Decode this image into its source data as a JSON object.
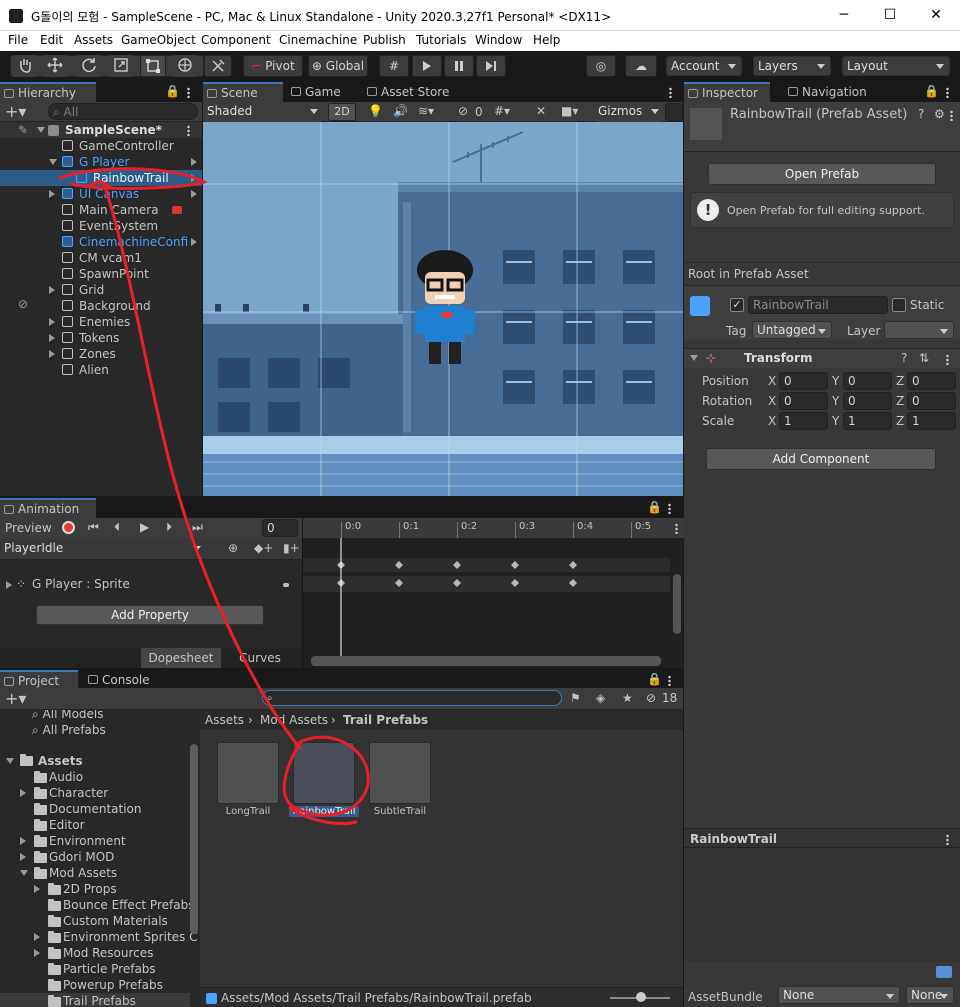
{
  "window": {
    "title": "G돌이의 모험 - SampleScene - PC, Mac & Linux Standalone - Unity 2020.3.27f1 Personal* <DX11>",
    "minimize": "─",
    "maximize": "☐",
    "close": "✕"
  },
  "menu": [
    "File",
    "Edit",
    "Assets",
    "GameObject",
    "Component",
    "Cinemachine",
    "Publish",
    "Tutorials",
    "Window",
    "Help"
  ],
  "toolbar": {
    "pivot": "Pivot",
    "global": "Global",
    "account": "Account",
    "layers": "Layers",
    "layout": "Layout",
    "tools": [
      "hand-tool",
      "move-tool",
      "rotate-tool",
      "scale-tool",
      "rect-tool",
      "transform-tool",
      "custom-tool"
    ]
  },
  "hierarchy": {
    "tab": "Hierarchy",
    "search_placeholder": "All",
    "scene": "SampleScene*",
    "items": [
      {
        "label": "GameController",
        "prefab": false
      },
      {
        "label": "G Player",
        "prefab": true
      },
      {
        "label": "RainbowTrail",
        "prefab": true
      },
      {
        "label": "UI Canvas",
        "prefab": true
      },
      {
        "label": "Main Camera",
        "prefab": false
      },
      {
        "label": "EventSystem",
        "prefab": false
      },
      {
        "label": "CinemachineConfi",
        "prefab": true
      },
      {
        "label": "CM vcam1",
        "prefab": false
      },
      {
        "label": "SpawnPoint",
        "prefab": false
      },
      {
        "label": "Grid",
        "prefab": false
      },
      {
        "label": "Background",
        "prefab": false
      },
      {
        "label": "Enemies",
        "prefab": false
      },
      {
        "label": "Tokens",
        "prefab": false
      },
      {
        "label": "Zones",
        "prefab": false
      },
      {
        "label": "Alien",
        "prefab": false
      }
    ]
  },
  "scene": {
    "tabs": [
      "Scene",
      "Game",
      "Asset Store"
    ],
    "shading": "Shaded",
    "mode2d": "2D",
    "hidden_count": "0",
    "gizmos": "Gizmos"
  },
  "animation": {
    "tab": "Animation",
    "preview": "Preview",
    "frame": "0",
    "clip": "PlayerIdle",
    "property": "G Player : Sprite",
    "add_property": "Add Property",
    "dopesheet": "Dopesheet",
    "curves": "Curves",
    "ticks": [
      "0:0",
      "0:1",
      "0:2",
      "0:3",
      "0:4",
      "0:5"
    ]
  },
  "project": {
    "tabs": [
      "Project",
      "Console"
    ],
    "hidden_count": "18",
    "favorites": [
      "All Models",
      "All Prefabs"
    ],
    "assets_root": "Assets",
    "tree": [
      {
        "label": "Audio",
        "level": 1,
        "expand": false
      },
      {
        "label": "Character",
        "level": 1,
        "expand": true
      },
      {
        "label": "Documentation",
        "level": 1,
        "expand": false
      },
      {
        "label": "Editor",
        "level": 1,
        "expand": false
      },
      {
        "label": "Environment",
        "level": 1,
        "expand": true
      },
      {
        "label": "Gdori MOD",
        "level": 1,
        "expand": true
      },
      {
        "label": "Mod Assets",
        "level": 1,
        "expand": "open"
      },
      {
        "label": "2D Props",
        "level": 2,
        "expand": true
      },
      {
        "label": "Bounce Effect Prefabs",
        "level": 2,
        "expand": false
      },
      {
        "label": "Custom Materials",
        "level": 2,
        "expand": false
      },
      {
        "label": "Environment Sprites C",
        "level": 2,
        "expand": true
      },
      {
        "label": "Mod Resources",
        "level": 2,
        "expand": true
      },
      {
        "label": "Particle Prefabs",
        "level": 2,
        "expand": false
      },
      {
        "label": "Powerup Prefabs",
        "level": 2,
        "expand": false
      },
      {
        "label": "Trail Prefabs",
        "level": 2,
        "expand": false
      }
    ],
    "breadcrumb": [
      "Assets",
      "Mod Assets",
      "Trail Prefabs"
    ],
    "files": [
      "LongTrail",
      "RainbowTrail",
      "SubtleTrail"
    ],
    "status_path": "Assets/Mod Assets/Trail Prefabs/RainbowTrail.prefab"
  },
  "inspector": {
    "tabs": [
      "Inspector",
      "Navigation"
    ],
    "asset_title": "RainbowTrail (Prefab Asset)",
    "open_prefab": "Open Prefab",
    "help": "Open Prefab for full editing support.",
    "root_label": "Root in Prefab Asset",
    "name": "RainbowTrail",
    "static": "Static",
    "tag_label": "Tag",
    "tag_value": "Untagged",
    "layer_label": "Layer",
    "layer_value": "",
    "transform": "Transform",
    "rows": [
      {
        "label": "Position",
        "x": "0",
        "y": "0",
        "z": "0"
      },
      {
        "label": "Rotation",
        "x": "0",
        "y": "0",
        "z": "0"
      },
      {
        "label": "Scale",
        "x": "1",
        "y": "1",
        "z": "1"
      }
    ],
    "axes": [
      "X",
      "Y",
      "Z"
    ],
    "add_component": "Add Component",
    "preview_name": "RainbowTrail",
    "assetbundle_label": "AssetBundle",
    "assetbundle_value": "None",
    "assetbundle_variant": "None"
  },
  "colors": {
    "accent": "#3a79bb",
    "annotation": "#e8202a",
    "prefab": "#4aa3ff"
  }
}
